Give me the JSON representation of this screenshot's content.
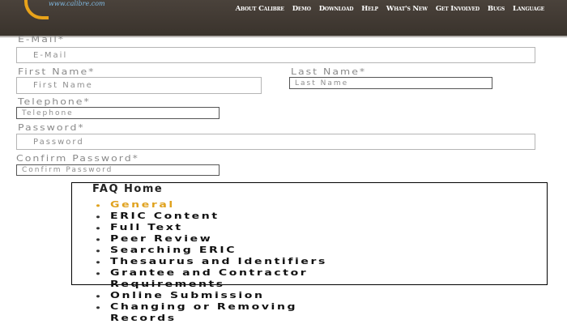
{
  "header": {
    "tagline": "www.calibre.com",
    "nav": [
      "About Calibre",
      "Demo",
      "Download",
      "Help",
      "What's New",
      "Get Involved",
      "Bugs",
      "Language"
    ]
  },
  "form": {
    "email": {
      "label": "E-Mail*",
      "placeholder": "E-Mail"
    },
    "first_name": {
      "label": "First Name*",
      "placeholder": "First Name"
    },
    "last_name": {
      "label": "Last Name*",
      "placeholder": "Last Name"
    },
    "telephone": {
      "label": "Telephone*",
      "placeholder": "Telephone"
    },
    "password": {
      "label": "Password*",
      "placeholder": "Password"
    },
    "confirm_password": {
      "label": "Confirm Password*",
      "placeholder": "Confirm Password"
    }
  },
  "faq": {
    "title": "FAQ Home",
    "items": [
      "General",
      "ERIC Content",
      "Full Text",
      "Peer Review",
      "Searching ERIC",
      "Thesaurus and Identifiers",
      "Grantee and Contractor",
      "Requirements",
      "Online Submission",
      "Changing or Removing",
      "Records"
    ],
    "active_color": "#e0a21e"
  },
  "colors": {
    "header_bg": "#3f3832",
    "accent": "#e8a31a"
  }
}
